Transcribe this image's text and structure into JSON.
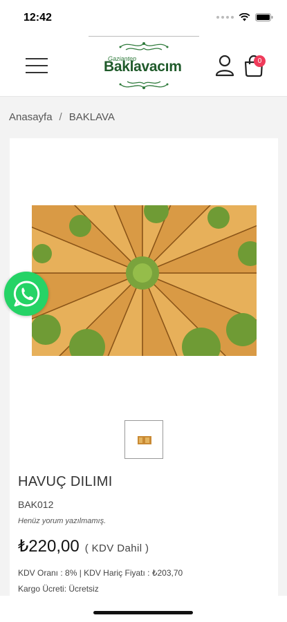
{
  "status_bar": {
    "time": "12:42"
  },
  "header": {
    "logo_small": "Gaziantep",
    "logo_text": "Baklavacım",
    "cart_count": "0"
  },
  "breadcrumb": {
    "home": "Anasayfa",
    "separator": "/",
    "current": "BAKLAVA"
  },
  "product": {
    "title": "HAVUÇ DILIMI",
    "code": "BAK012",
    "review_note": "Henüz yorum yazılmamış.",
    "price": "₺220,00",
    "kdv_label": "( KDV Dahil )",
    "tax_info": "KDV Oranı : 8% | KDV Hariç Fiyatı : ₺203,70",
    "cargo_info": "Kargo Ücreti: Ücretsiz"
  },
  "colors": {
    "brand_green": "#1f5a2a",
    "whatsapp_green": "#25d366",
    "badge_red": "#ef3b5a"
  },
  "icons": [
    "menu-icon",
    "user-icon",
    "shopping-bag-icon",
    "whatsapp-icon",
    "wifi-icon",
    "battery-icon"
  ]
}
